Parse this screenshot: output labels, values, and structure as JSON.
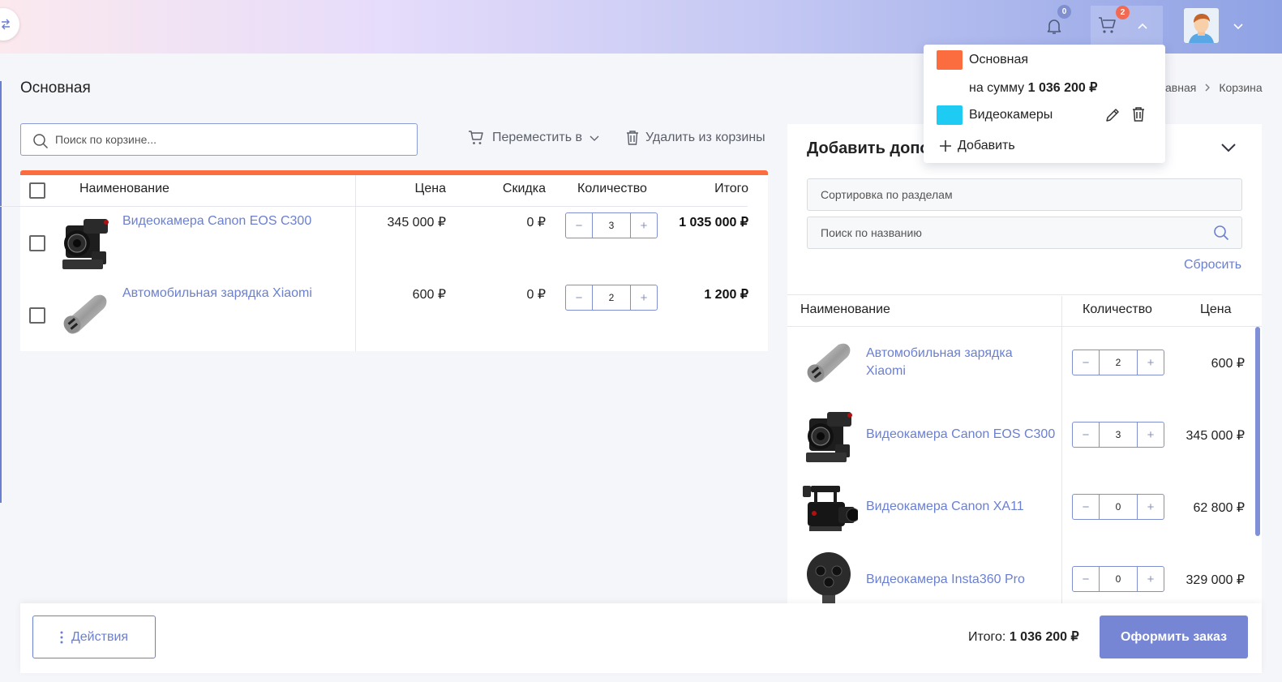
{
  "header": {
    "notifications_count": "0",
    "cart_count": "2"
  },
  "page": {
    "title": "Основная",
    "breadcrumb": [
      "авная",
      "Корзина"
    ]
  },
  "toolbar": {
    "search_placeholder": "Поиск по корзине...",
    "move_label": "Переместить в",
    "delete_label": "Удалить из корзины"
  },
  "cart_table": {
    "columns": [
      "Наименование",
      "Цена",
      "Скидка",
      "Количество",
      "Итого"
    ],
    "accent_color": "#fb6d3f",
    "rows": [
      {
        "name": "Видеокамера Canon EOS C300",
        "price": "345 000 ₽",
        "discount": "0 ₽",
        "qty": "3",
        "total": "1 035 000 ₽",
        "image": "camera-c300"
      },
      {
        "name": "Автомобильная зарядка Xiaomi",
        "price": "600 ₽",
        "discount": "0 ₽",
        "qty": "2",
        "total": "1 200 ₽",
        "image": "car-charger"
      }
    ]
  },
  "dropdown": {
    "carts": [
      {
        "name": "Основная",
        "color": "#fb6d3f",
        "sum_label": "на сумму",
        "sum": "1 036 200 ₽"
      },
      {
        "name": "Видеокамеры",
        "color": "#1ecbf2"
      }
    ],
    "add_label": "Добавить"
  },
  "right_panel": {
    "title": "Добавить допо...",
    "sort_placeholder": "Сортировка по разделам",
    "search_placeholder": "Поиск по названию",
    "reset_label": "Сбросить",
    "columns": [
      "Наименование",
      "Количество",
      "Цена"
    ],
    "items": [
      {
        "name_lines": [
          "Автомобильная зарядка",
          "Xiaomi"
        ],
        "qty": "2",
        "price": "600 ₽",
        "image": "car-charger"
      },
      {
        "name_lines": [
          "Видеокамера Canon EOS C300"
        ],
        "qty": "3",
        "price": "345 000 ₽",
        "image": "camera-c300"
      },
      {
        "name_lines": [
          "Видеокамера Canon XA11"
        ],
        "qty": "0",
        "price": "62 800 ₽",
        "image": "camera-xa11"
      },
      {
        "name_lines": [
          "Видеокамера Insta360 Pro"
        ],
        "qty": "0",
        "price": "329 000 ₽",
        "image": "camera-insta360"
      }
    ]
  },
  "footer": {
    "actions_label": "Действия",
    "total_label": "Итого:",
    "total_value": "1 036 200 ₽",
    "order_label": "Оформить заказ"
  }
}
